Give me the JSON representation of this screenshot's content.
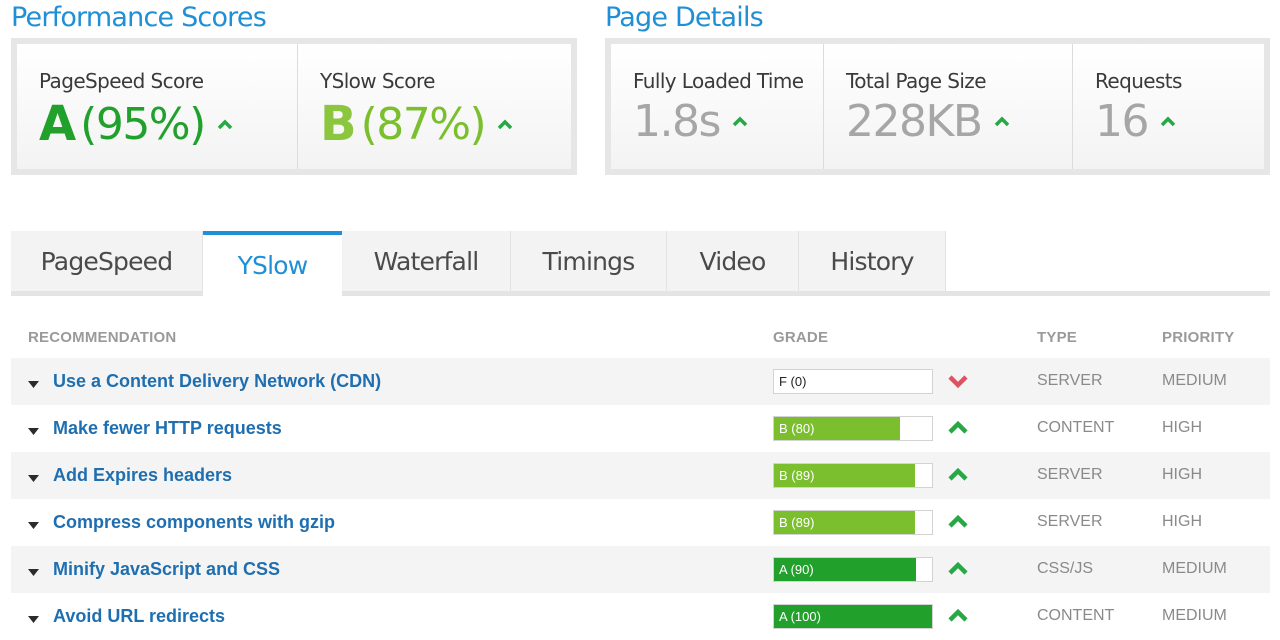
{
  "performance": {
    "title": "Performance Scores",
    "metrics": [
      {
        "label": "PageSpeed Score",
        "grade": "A",
        "pct": "(95%)"
      },
      {
        "label": "YSlow Score",
        "grade": "B",
        "pct": "(87%)"
      }
    ]
  },
  "details": {
    "title": "Page Details",
    "metrics": [
      {
        "label": "Fully Loaded Time",
        "value": "1.8s"
      },
      {
        "label": "Total Page Size",
        "value": "228KB"
      },
      {
        "label": "Requests",
        "value": "16"
      }
    ]
  },
  "tabs": [
    "PageSpeed",
    "YSlow",
    "Waterfall",
    "Timings",
    "Video",
    "History"
  ],
  "active_tab": "YSlow",
  "table": {
    "headers": {
      "recommendation": "RECOMMENDATION",
      "grade": "GRADE",
      "type": "TYPE",
      "priority": "PRIORITY"
    },
    "rows": [
      {
        "recommendation": "Use a Content Delivery Network (CDN)",
        "grade": "F (0)",
        "score": 0,
        "trend": "down",
        "type": "SERVER",
        "priority": "MEDIUM"
      },
      {
        "recommendation": "Make fewer HTTP requests",
        "grade": "B (80)",
        "score": 80,
        "trend": "up",
        "type": "CONTENT",
        "priority": "HIGH"
      },
      {
        "recommendation": "Add Expires headers",
        "grade": "B (89)",
        "score": 89,
        "trend": "up",
        "type": "SERVER",
        "priority": "HIGH"
      },
      {
        "recommendation": "Compress components with gzip",
        "grade": "B (89)",
        "score": 89,
        "trend": "up",
        "type": "SERVER",
        "priority": "HIGH"
      },
      {
        "recommendation": "Minify JavaScript and CSS",
        "grade": "A (90)",
        "score": 90,
        "trend": "up",
        "type": "CSS/JS",
        "priority": "MEDIUM"
      },
      {
        "recommendation": "Avoid URL redirects",
        "grade": "A (100)",
        "score": 100,
        "trend": "up",
        "type": "CONTENT",
        "priority": "MEDIUM"
      }
    ]
  },
  "colors": {
    "accent": "#1f8fd6",
    "grade_a": "#22a02c",
    "grade_b": "#7bbf2e",
    "trend_up": "#28a745",
    "trend_down": "#e0525f"
  },
  "icons": {
    "trend_up": "chevron-up-icon",
    "trend_down": "chevron-down-icon",
    "expand": "triangle-down-icon"
  }
}
